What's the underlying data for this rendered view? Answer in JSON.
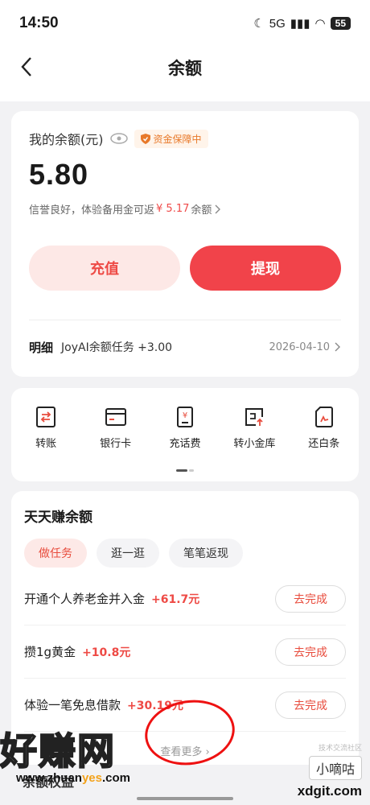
{
  "status_bar": {
    "time": "14:50",
    "network": "5G",
    "battery": "55"
  },
  "nav": {
    "title": "余额"
  },
  "balance": {
    "label": "我的余额(元)",
    "badge": "资金保障中",
    "amount": "5.80",
    "credit_prefix": "信誉良好，体验备用金可返",
    "credit_amount": "¥ 5.17",
    "credit_suffix": "余额",
    "recharge_label": "充值",
    "withdraw_label": "提现",
    "detail_label": "明细",
    "detail_text": "JoyAI余额任务 +3.00",
    "detail_date": "2026-04-10"
  },
  "shortcuts": [
    {
      "label": "转账",
      "icon": "transfer-icon"
    },
    {
      "label": "银行卡",
      "icon": "bank-card-icon"
    },
    {
      "label": "充话费",
      "icon": "phone-bill-icon"
    },
    {
      "label": "转小金库",
      "icon": "vault-transfer-icon"
    },
    {
      "label": "还白条",
      "icon": "repay-icon"
    }
  ],
  "earn": {
    "title": "天天赚余额",
    "tabs": [
      "做任务",
      "逛一逛",
      "笔笔返现"
    ],
    "tasks": [
      {
        "name": "开通个人养老金并入金",
        "reward": "+61.7元",
        "action": "去完成"
      },
      {
        "name": "攒1g黄金",
        "reward": "+10.8元",
        "action": "去完成"
      },
      {
        "name": "体验一笔免息借款",
        "reward": "+30.19元",
        "action": "去完成"
      }
    ],
    "see_more": "查看更多"
  },
  "next_section_title": "余额权益",
  "watermark": {
    "left_big": "好赚网",
    "left_url_1": "www.zhuan",
    "left_url_2": "yes",
    "left_url_3": ".com",
    "right_small": "技术交流社区",
    "right_box": "小嘀咕",
    "right_domain": "xdgit.com"
  },
  "colors": {
    "accent": "#f1434a",
    "badge": "#e8792a"
  }
}
